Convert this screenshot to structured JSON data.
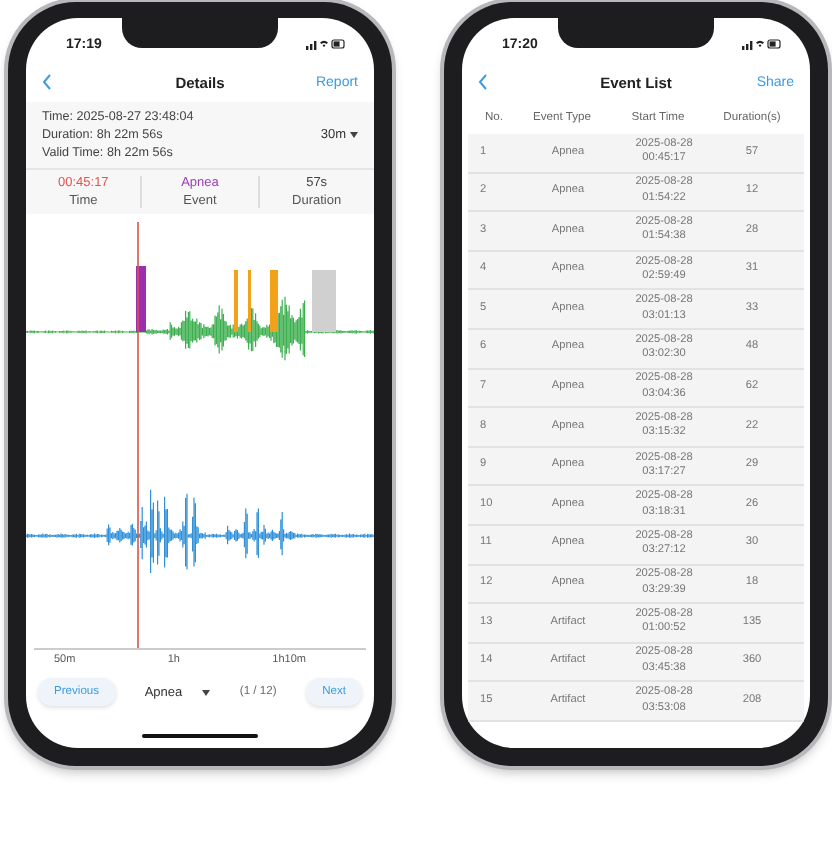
{
  "details_screen": {
    "status_time": "17:19",
    "title": "Details",
    "action": "Report",
    "info": [
      {
        "label": "Time:",
        "value": "2025-08-27 23:48:04"
      },
      {
        "label": "Duration:",
        "value": "8h 22m 56s"
      },
      {
        "label": "Valid Time:",
        "value": "8h 22m 56s"
      }
    ],
    "range": "30m",
    "stats": [
      {
        "value": "00:45:17",
        "label": "Time",
        "color": "#e0564e"
      },
      {
        "value": "Apnea",
        "label": "Event",
        "color": "#9c3db8"
      },
      {
        "value": "57s",
        "label": "Duration",
        "color": "#444444"
      }
    ],
    "axis_labels": [
      "50m",
      "1h",
      "1h10m"
    ],
    "nav": {
      "previous": "Previous",
      "filter": "Apnea",
      "position": "(1 / 12)",
      "next": "Next"
    }
  },
  "event_list_screen": {
    "status_time": "17:20",
    "title": "Event List",
    "action": "Share",
    "columns": [
      "No.",
      "Event Type",
      "Start Time",
      "Duration(s)"
    ],
    "rows": [
      {
        "no": "1",
        "type": "Apnea",
        "start": "2025-08-28 00:45:17",
        "duration": "57"
      },
      {
        "no": "2",
        "type": "Apnea",
        "start": "2025-08-28 01:54:22",
        "duration": "12"
      },
      {
        "no": "3",
        "type": "Apnea",
        "start": "2025-08-28 01:54:38",
        "duration": "28"
      },
      {
        "no": "4",
        "type": "Apnea",
        "start": "2025-08-28 02:59:49",
        "duration": "31"
      },
      {
        "no": "5",
        "type": "Apnea",
        "start": "2025-08-28 03:01:13",
        "duration": "33"
      },
      {
        "no": "6",
        "type": "Apnea",
        "start": "2025-08-28 03:02:30",
        "duration": "48"
      },
      {
        "no": "7",
        "type": "Apnea",
        "start": "2025-08-28 03:04:36",
        "duration": "62"
      },
      {
        "no": "8",
        "type": "Apnea",
        "start": "2025-08-28 03:15:32",
        "duration": "22"
      },
      {
        "no": "9",
        "type": "Apnea",
        "start": "2025-08-28 03:17:27",
        "duration": "29"
      },
      {
        "no": "10",
        "type": "Apnea",
        "start": "2025-08-28 03:18:31",
        "duration": "26"
      },
      {
        "no": "11",
        "type": "Apnea",
        "start": "2025-08-28 03:27:12",
        "duration": "30"
      },
      {
        "no": "12",
        "type": "Apnea",
        "start": "2025-08-28 03:29:39",
        "duration": "18"
      },
      {
        "no": "13",
        "type": "Artifact",
        "start": "2025-08-28 01:00:52",
        "duration": "135"
      },
      {
        "no": "14",
        "type": "Artifact",
        "start": "2025-08-28 03:45:38",
        "duration": "360"
      },
      {
        "no": "15",
        "type": "Artifact",
        "start": "2025-08-28 03:53:08",
        "duration": "208"
      }
    ]
  }
}
